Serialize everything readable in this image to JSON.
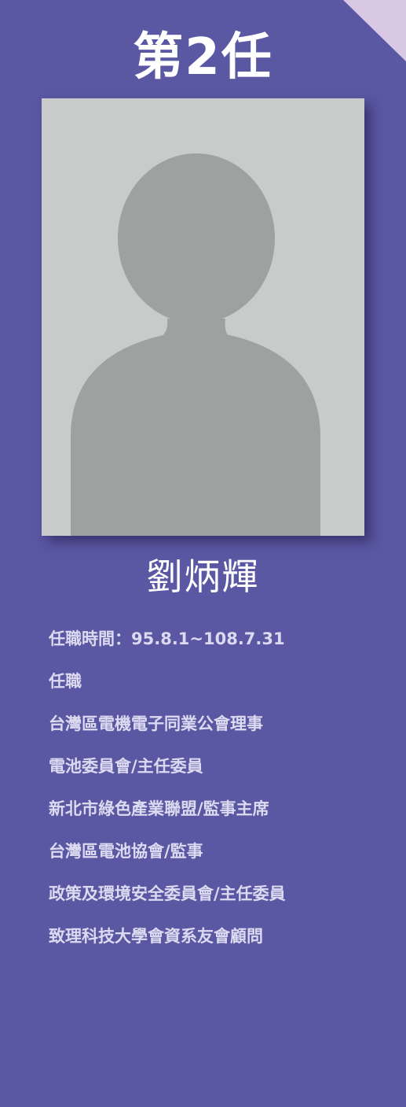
{
  "header": {
    "term": "第2任"
  },
  "profile": {
    "name": "劉炳輝",
    "photo_icon": "person-silhouette-icon"
  },
  "details": {
    "tenure": "任職時間：95.8.1~108.7.31",
    "positions_heading": "任職",
    "positions": [
      "台灣區電機電子同業公會理事",
      "電池委員會/主任委員",
      "新北市綠色產業聯盟/監事主席",
      "台灣區電池協會/監事",
      "政策及環境安全委員會/主任委員",
      "致理科技大學會資系友會顧問"
    ]
  },
  "colors": {
    "background": "#5a57a3",
    "corner_accent": "#d9c8e4",
    "photo_background": "#c9cbca",
    "silhouette": "#9fa0a0",
    "title_text": "#ffffff",
    "body_text": "#dcdaf0"
  }
}
